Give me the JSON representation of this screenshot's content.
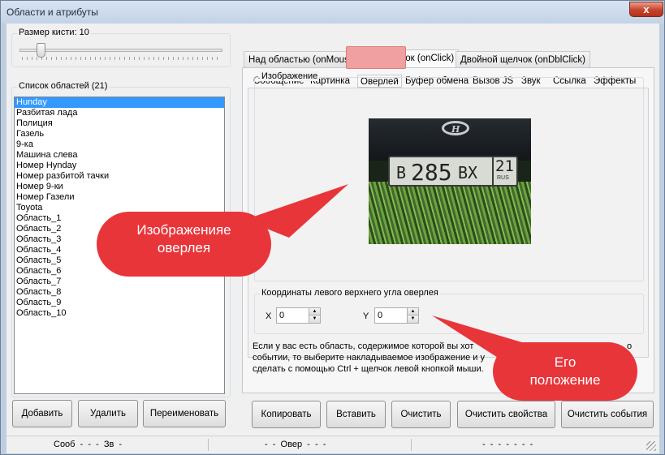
{
  "window": {
    "title": "Области и атрибуты",
    "close_glyph": "x"
  },
  "brush": {
    "label": "Размер кисти:",
    "value": "10"
  },
  "areas": {
    "label": "Список областей (21)",
    "items": [
      "Hunday",
      "Разбитая лада",
      "Полиция",
      "Газель",
      "9-ка",
      "Машина слева",
      "Номер Hynday",
      "Номер разбитой тачки",
      "Номер 9-ки",
      "Номер Газели",
      "Toyota",
      "Область_1",
      "Область_2",
      "Область_3",
      "Область_4",
      "Область_5",
      "Область_6",
      "Область_7",
      "Область_8",
      "Область_9",
      "Область_10"
    ],
    "selected_index": 0
  },
  "left_buttons": {
    "add": "Добавить",
    "delete": "Удалить",
    "rename": "Переименовать"
  },
  "tabs": [
    "Над областью (onMouseOver)",
    "Щелчок (onClick)",
    "Двойной щелчок (onDblClick)"
  ],
  "active_tab": 1,
  "subtabs": [
    "Сообщение",
    "Картинка",
    "Оверлей",
    "Буфер обмена",
    "Вызов JS",
    "Звук",
    "Ссылка",
    "Эффекты"
  ],
  "active_subtab": 2,
  "image_group": {
    "label": "Изображение"
  },
  "plate": {
    "left": "B",
    "digits": "285",
    "right": "BX",
    "region": "21",
    "rus": "RUS"
  },
  "coords": {
    "label": "Координаты левого верхнего угла оверлея",
    "x_label": "X",
    "x_value": "0",
    "y_label": "Y",
    "y_value": "0"
  },
  "help_text": {
    "line1": "Если у вас есть область, содержимое которой вы хот",
    "line1_end": "о",
    "line2": "событии, то выберите накладываемое изображение и у",
    "line2_end": "о",
    "line3": "сделать с помощью Ctrl + щелчок левой кнопкой мыши."
  },
  "bottom_buttons": {
    "copy": "Копировать",
    "paste": "Вставить",
    "clear": "Очистить",
    "clear_props": "Очистить свойства",
    "clear_events": "Очистить события"
  },
  "callouts": {
    "overlay_line1": "Изображенияе",
    "overlay_line2": "оверлея",
    "position_line1": "Его",
    "position_line2": "положение"
  },
  "status": {
    "seg1": "Сооб  -  -  -  Зв  -",
    "seg2": "-  -  Овер  -  -  -",
    "seg3": "-  -  -  -  -  -  -"
  },
  "colors": {
    "callout": "#e8353a",
    "highlight": "#f0a0a0",
    "selection": "#3399ff"
  }
}
